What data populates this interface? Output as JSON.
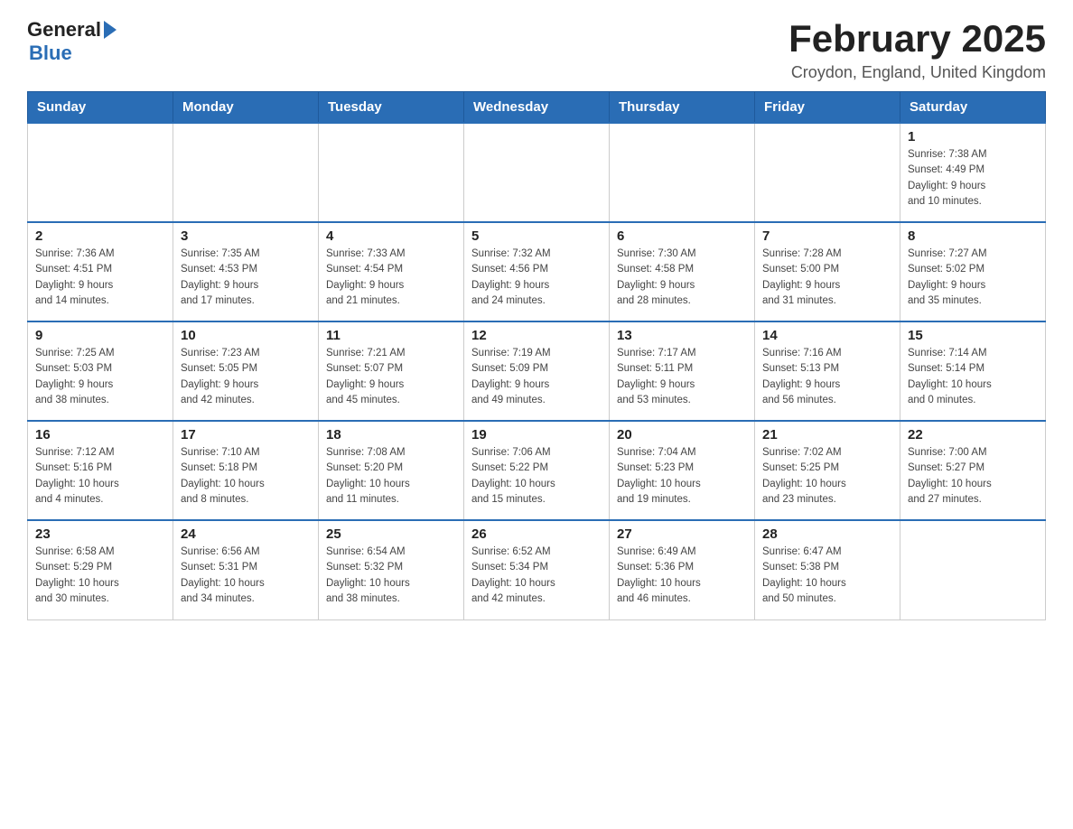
{
  "header": {
    "logo_general": "General",
    "logo_blue": "Blue",
    "month_title": "February 2025",
    "location": "Croydon, England, United Kingdom"
  },
  "weekdays": [
    "Sunday",
    "Monday",
    "Tuesday",
    "Wednesday",
    "Thursday",
    "Friday",
    "Saturday"
  ],
  "weeks": [
    [
      {
        "day": "",
        "info": ""
      },
      {
        "day": "",
        "info": ""
      },
      {
        "day": "",
        "info": ""
      },
      {
        "day": "",
        "info": ""
      },
      {
        "day": "",
        "info": ""
      },
      {
        "day": "",
        "info": ""
      },
      {
        "day": "1",
        "info": "Sunrise: 7:38 AM\nSunset: 4:49 PM\nDaylight: 9 hours\nand 10 minutes."
      }
    ],
    [
      {
        "day": "2",
        "info": "Sunrise: 7:36 AM\nSunset: 4:51 PM\nDaylight: 9 hours\nand 14 minutes."
      },
      {
        "day": "3",
        "info": "Sunrise: 7:35 AM\nSunset: 4:53 PM\nDaylight: 9 hours\nand 17 minutes."
      },
      {
        "day": "4",
        "info": "Sunrise: 7:33 AM\nSunset: 4:54 PM\nDaylight: 9 hours\nand 21 minutes."
      },
      {
        "day": "5",
        "info": "Sunrise: 7:32 AM\nSunset: 4:56 PM\nDaylight: 9 hours\nand 24 minutes."
      },
      {
        "day": "6",
        "info": "Sunrise: 7:30 AM\nSunset: 4:58 PM\nDaylight: 9 hours\nand 28 minutes."
      },
      {
        "day": "7",
        "info": "Sunrise: 7:28 AM\nSunset: 5:00 PM\nDaylight: 9 hours\nand 31 minutes."
      },
      {
        "day": "8",
        "info": "Sunrise: 7:27 AM\nSunset: 5:02 PM\nDaylight: 9 hours\nand 35 minutes."
      }
    ],
    [
      {
        "day": "9",
        "info": "Sunrise: 7:25 AM\nSunset: 5:03 PM\nDaylight: 9 hours\nand 38 minutes."
      },
      {
        "day": "10",
        "info": "Sunrise: 7:23 AM\nSunset: 5:05 PM\nDaylight: 9 hours\nand 42 minutes."
      },
      {
        "day": "11",
        "info": "Sunrise: 7:21 AM\nSunset: 5:07 PM\nDaylight: 9 hours\nand 45 minutes."
      },
      {
        "day": "12",
        "info": "Sunrise: 7:19 AM\nSunset: 5:09 PM\nDaylight: 9 hours\nand 49 minutes."
      },
      {
        "day": "13",
        "info": "Sunrise: 7:17 AM\nSunset: 5:11 PM\nDaylight: 9 hours\nand 53 minutes."
      },
      {
        "day": "14",
        "info": "Sunrise: 7:16 AM\nSunset: 5:13 PM\nDaylight: 9 hours\nand 56 minutes."
      },
      {
        "day": "15",
        "info": "Sunrise: 7:14 AM\nSunset: 5:14 PM\nDaylight: 10 hours\nand 0 minutes."
      }
    ],
    [
      {
        "day": "16",
        "info": "Sunrise: 7:12 AM\nSunset: 5:16 PM\nDaylight: 10 hours\nand 4 minutes."
      },
      {
        "day": "17",
        "info": "Sunrise: 7:10 AM\nSunset: 5:18 PM\nDaylight: 10 hours\nand 8 minutes."
      },
      {
        "day": "18",
        "info": "Sunrise: 7:08 AM\nSunset: 5:20 PM\nDaylight: 10 hours\nand 11 minutes."
      },
      {
        "day": "19",
        "info": "Sunrise: 7:06 AM\nSunset: 5:22 PM\nDaylight: 10 hours\nand 15 minutes."
      },
      {
        "day": "20",
        "info": "Sunrise: 7:04 AM\nSunset: 5:23 PM\nDaylight: 10 hours\nand 19 minutes."
      },
      {
        "day": "21",
        "info": "Sunrise: 7:02 AM\nSunset: 5:25 PM\nDaylight: 10 hours\nand 23 minutes."
      },
      {
        "day": "22",
        "info": "Sunrise: 7:00 AM\nSunset: 5:27 PM\nDaylight: 10 hours\nand 27 minutes."
      }
    ],
    [
      {
        "day": "23",
        "info": "Sunrise: 6:58 AM\nSunset: 5:29 PM\nDaylight: 10 hours\nand 30 minutes."
      },
      {
        "day": "24",
        "info": "Sunrise: 6:56 AM\nSunset: 5:31 PM\nDaylight: 10 hours\nand 34 minutes."
      },
      {
        "day": "25",
        "info": "Sunrise: 6:54 AM\nSunset: 5:32 PM\nDaylight: 10 hours\nand 38 minutes."
      },
      {
        "day": "26",
        "info": "Sunrise: 6:52 AM\nSunset: 5:34 PM\nDaylight: 10 hours\nand 42 minutes."
      },
      {
        "day": "27",
        "info": "Sunrise: 6:49 AM\nSunset: 5:36 PM\nDaylight: 10 hours\nand 46 minutes."
      },
      {
        "day": "28",
        "info": "Sunrise: 6:47 AM\nSunset: 5:38 PM\nDaylight: 10 hours\nand 50 minutes."
      },
      {
        "day": "",
        "info": ""
      }
    ]
  ]
}
